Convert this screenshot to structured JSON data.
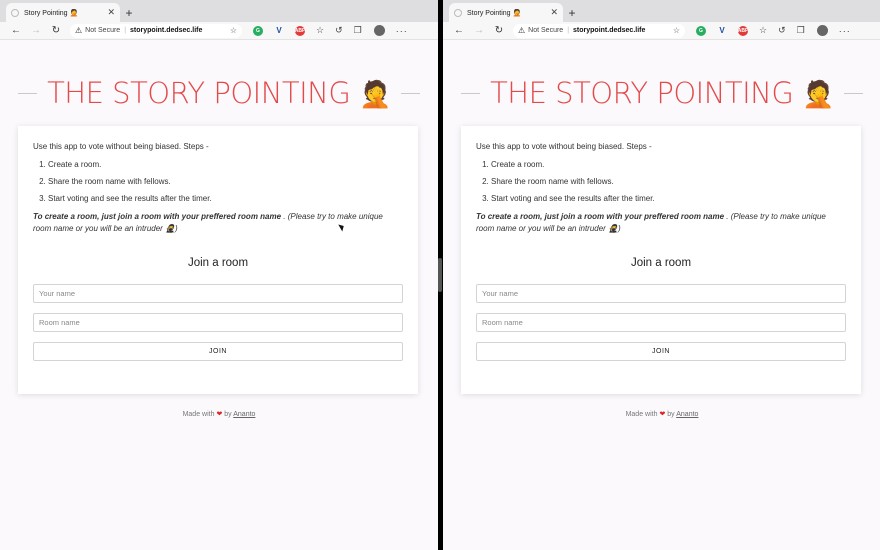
{
  "browser": {
    "tab_title": "Story Pointing 🤦",
    "tab_close": "✕",
    "new_tab": "+",
    "not_secure": "Not Secure",
    "url": "storypoint.dedsec.life",
    "ext_abp": "ABP"
  },
  "page": {
    "title": "THE STORY POINTING",
    "title_emoji": "🤦",
    "intro": "Use this app to vote without being biased. Steps -",
    "steps": [
      "Create a room.",
      "Share the room name with fellows.",
      "Start voting and see the results after the timer."
    ],
    "note_bold": "To create a room, just join a room with your preffered room name",
    "note_rest": " . (Please try to make unique room name or you will be an intruder 🥷)",
    "join_title": "Join a room",
    "name_placeholder": "Your name",
    "room_placeholder": "Room name",
    "join_label": "JOIN",
    "footer_prefix": "Made with",
    "footer_heart": "❤",
    "footer_by": "by",
    "footer_author": "Ananto"
  }
}
